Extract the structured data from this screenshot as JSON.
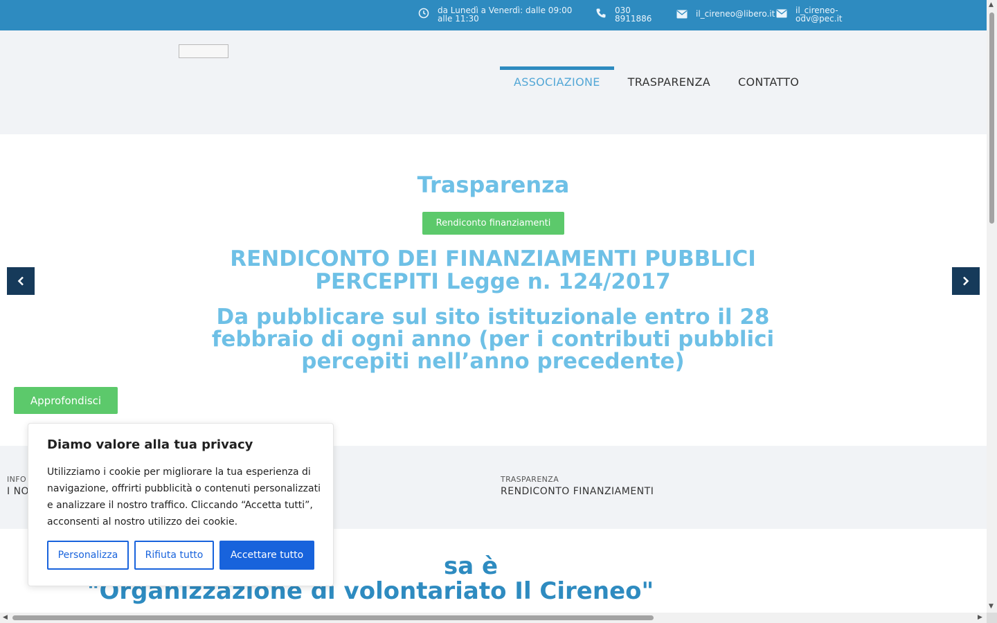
{
  "topbar": {
    "hours_line1": "da Lunedì a Venerdì: dalle 09:00",
    "hours_line2": "alle 11:30",
    "phone_line1": "030",
    "phone_line2": "8911886",
    "email1": "il_cireneo@libero.it",
    "email2_line1": "il_cireneo-",
    "email2_line2": "odv@pec.it"
  },
  "nav": {
    "items": [
      {
        "label": "ASSOCIAZIONE",
        "active": true
      },
      {
        "label": "TRASPARENZA",
        "active": false
      },
      {
        "label": "CONTATTO",
        "active": false
      }
    ]
  },
  "hero": {
    "title": "Trasparenza",
    "pill": "Rendiconto finanziamenti",
    "heading": "RENDICONTO DEI FINANZIAMENTI PUBBLICI PERCEPITI Legge n. 124/2017",
    "subheading": "Da pubblicare sul sito istituzionale entro il 28 febbraio di ogni anno (per i contributi pubblici percepiti nell’anno precedente)",
    "more_button": "Approfondisci"
  },
  "strip": {
    "left": {
      "category": "INFO",
      "title": "I NO"
    },
    "right": {
      "category": "TRASPARENZA",
      "title": "RENDICONTO FINANZIAMENTI"
    }
  },
  "about": {
    "line1": "sa è",
    "line2": "\"Organizzazione di volontariato Il Cireneo\""
  },
  "cookie": {
    "title": "Diamo valore alla tua privacy",
    "text": "Utilizziamo i cookie per migliorare la tua esperienza di navigazione, offrirti pubblicità o contenuti personalizzati e analizzare il nostro traffico. Cliccando “Accetta tutti”, acconsenti al nostro utilizzo dei cookie.",
    "customize": "Personalizza",
    "reject": "Rifiuta tutto",
    "accept": "Accettare tutto"
  },
  "colors": {
    "topbar": "#2e8bc0",
    "accent_light": "#6ec0e6",
    "green": "#5cc96b",
    "navy_arrow": "#163a5a",
    "cookie_blue": "#1863dc"
  }
}
